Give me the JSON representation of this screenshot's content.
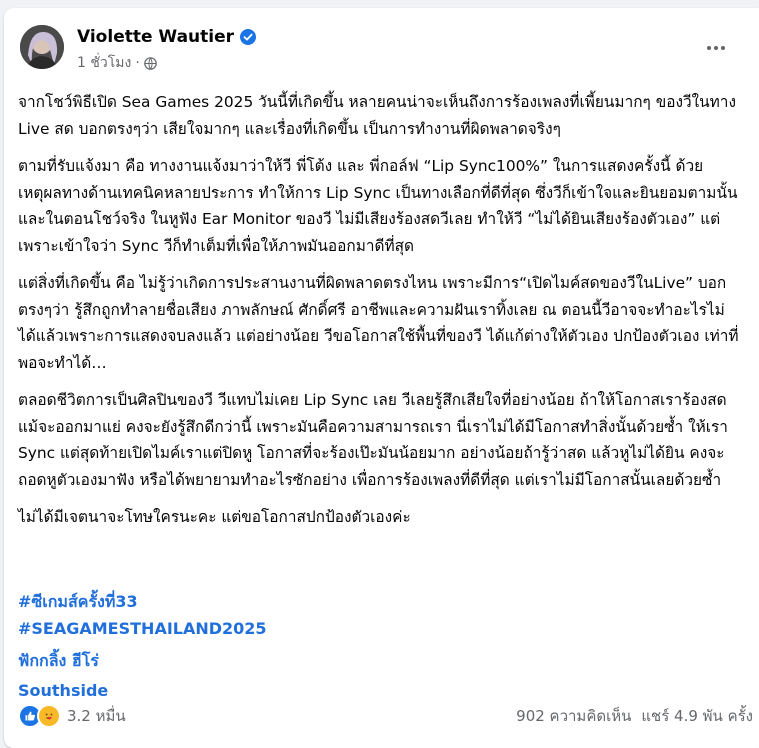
{
  "post": {
    "author": "Violette Wautier",
    "verified": true,
    "timestamp": "1 ชั่วโมง",
    "separator": "·",
    "privacy_icon": "globe-icon",
    "more_icon": "more-horizontal-icon"
  },
  "paragraphs": [
    "จากโชว์พิธีเปิด Sea Games 2025 วันนี้ที่เกิดขึ้น หลายคนน่าจะเห็นถึงการร้องเพลงที่เพี้ยนมากๆ ของวีในทาง Live สด บอกตรงๆว่า เสียใจมากๆ และเรื่องที่เกิดขึ้น เป็นการทำงานที่ผิดพลาดจริงๆ",
    "ตามที่รับแจ้งมา คือ ทางงานแจ้งมาว่าให้วี พี่โต้ง และ พี่กอล์ฟ “Lip Sync100%” ในการแสดงครั้งนี้ ด้วยเหตุผลทางด้านเทคนิคหลายประการ ทำให้การ Lip Sync เป็นทางเลือกที่ดีที่สุด ซึ่งวีก็เข้าใจและยินยอมตามนั้น และในตอนโชว์จริง ในหูฟัง Ear Monitor ของวี ไม่มีเสียงร้องสดวีเลย ทำให้วี “ไม่ได้ยินเสียงร้องตัวเอง” แต่เพราะเข้าใจว่า Sync วีก็ทำเต็มที่เพื่อให้ภาพมันออกมาดีที่สุด",
    "แต่สิ่งที่เกิดขึ้น คือ ไม่รู้ว่าเกิดการประสานงานที่ผิดพลาดตรงไหน เพราะมีการ“เปิดไมค์สดของวีในLive”  บอกตรงๆว่า รู้สึกถูกทำลายชื่อเสียง ภาพลักษณ์ ศักดิ์ศรี อาชีพและความฝันเราทิ้งเลย ณ ตอนนี้วีอาจจะทำอะไรไม่ได้แล้วเพราะการแสดงจบลงแล้ว แต่อย่างน้อย วีขอโอกาสใช้พื้นที่ของวี ได้แก้ต่างให้ตัวเอง ปกป้องตัวเอง เท่าที่พอจะทำได้…",
    "ตลอดชีวิตการเป็นศิลปินของวี วีแทบไม่เคย Lip Sync เลย วีเลยรู้สึกเสียใจที่อย่างน้อย ถ้าให้โอกาสเราร้องสด แม้จะออกมาแย่ คงจะยังรู้สึกดีกว่านี้ เพราะมันคือความสามารถเรา นี่เราไม่ได้มีโอกาสทำสิ่งนั้นด้วยซ้ำ ให้เรา Sync แต่สุดท้ายเปิดไมค์เราแต่ปิดหู โอกาสที่จะร้องเป๊ะมันน้อยมาก อย่างน้อยถ้ารู้ว่าสด แล้วหูไม่ได้ยิน คงจะถอดหูตัวเองมาฟัง หรือได้พยายามทำอะไรซักอย่าง เพื่อการร้องเพลงที่ดีที่สุด แต่เราไม่มีโอกาสนั้นเลยด้วยซ้ำ",
    "ไม่ได้มีเจตนาจะโทษใครนะคะ แต่ขอโอกาสปกป้องตัวเองค่ะ"
  ],
  "hashtags": [
    "#ซีเกมส์ครั้งที่33",
    "#SEAGAMESTHAILAND2025"
  ],
  "tags": [
    "ฟักกลิ้ง ฮีโร่",
    "Southside"
  ],
  "footer": {
    "reaction_icons": [
      "like-icon",
      "care-icon"
    ],
    "reaction_count": "3.2 หมื่น",
    "comments": "902 ความคิดเห็น",
    "shares": "แชร์ 4.9 พัน ครั้ง"
  },
  "colors": {
    "link": "#216fdb",
    "secondary_text": "#65676b",
    "verified": "#1b74e4",
    "like": "#1b74e4",
    "care": "#f7b928"
  }
}
